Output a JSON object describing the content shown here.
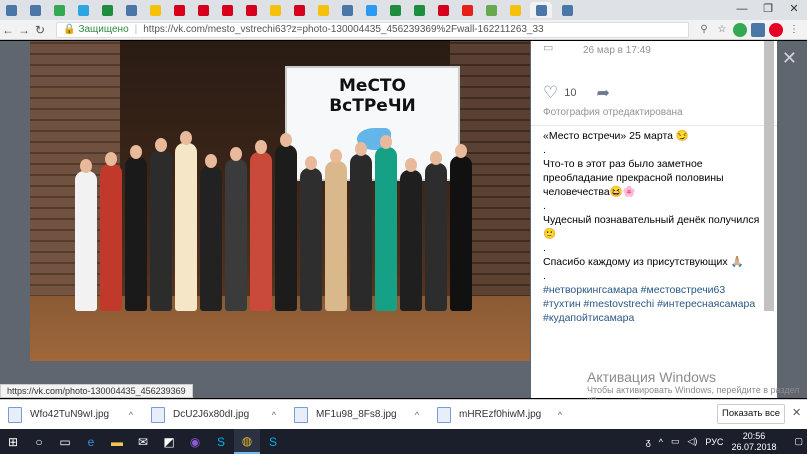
{
  "browser": {
    "tabs": [
      {
        "icon": "vk-icon",
        "color": "#4a76a8"
      },
      {
        "icon": "vk-icon",
        "color": "#4a76a8"
      },
      {
        "icon": "g-icon",
        "color": "#34a853"
      },
      {
        "icon": "telegram-icon",
        "color": "#2ca5e0"
      },
      {
        "icon": "flag-icon",
        "color": "#1e8e3e"
      },
      {
        "icon": "vk-icon",
        "color": "#4a76a8"
      },
      {
        "icon": "yellow-icon",
        "color": "#f4c20d"
      },
      {
        "icon": "hh-icon",
        "color": "#d6001c"
      },
      {
        "icon": "hh-icon",
        "color": "#d6001c"
      },
      {
        "icon": "hh-icon",
        "color": "#d6001c"
      },
      {
        "icon": "square-icon",
        "color": "#d6001c"
      },
      {
        "icon": "yellow-icon",
        "color": "#f4c20d"
      },
      {
        "icon": "hh-icon",
        "color": "#d6001c"
      },
      {
        "icon": "yellow-icon",
        "color": "#f4c20d"
      },
      {
        "icon": "vk-icon",
        "color": "#4a76a8"
      },
      {
        "icon": "mail-icon",
        "color": "#2a9af3"
      },
      {
        "icon": "flag-icon",
        "color": "#1e8e3e"
      },
      {
        "icon": "flag-icon",
        "color": "#1e8e3e"
      },
      {
        "icon": "hh-icon",
        "color": "#d6001c"
      },
      {
        "icon": "youtube-icon",
        "color": "#e62117"
      },
      {
        "icon": "sheet-icon",
        "color": "#6aa84f"
      },
      {
        "icon": "yellow-icon",
        "color": "#f4c20d"
      },
      {
        "icon": "vk-icon",
        "color": "#4a76a8"
      },
      {
        "icon": "vk-icon",
        "color": "#4a76a8"
      }
    ],
    "secure_label": "Защищено",
    "url": "https://vk.com/mesto_vstrechi63?z=photo-130004435_456239369%2Fwall-162211263_33"
  },
  "photo": {
    "screen_line1": "МеСТО",
    "screen_line2": "ВсТРеЧИ"
  },
  "post": {
    "date": "26 мар в 17:49",
    "likes": "10",
    "edited": "Фотография отредактирована",
    "lines": [
      "«Место встречи» 25 марта 😏",
      ".",
      "Что-то в этот раз было заметное преобладание прекрасной половины человечества😆🌸",
      ".",
      "Чудесный познавательный денёк получился 🙂",
      ".",
      "Спасибо каждому из присутствующих 🙏🏼",
      "."
    ],
    "tags_line1": "#нетворкингсамара #местовстречи63",
    "tags_line2": "#тухтин #mestovstrechi #интереснаясамара",
    "tags_line3": "#кудапойтисамара"
  },
  "windows_watermark": {
    "title": "Активация Windows",
    "text": "Чтобы активировать Windows, перейдите в раздел \"Параметры\"."
  },
  "status_url": "https://vk.com/photo-130004435_456239369",
  "downloads": [
    {
      "name": "Wfo42TuN9wI.jpg"
    },
    {
      "name": "DcU2J6x80dI.jpg"
    },
    {
      "name": "MF1u98_8Fs8.jpg"
    },
    {
      "name": "mHREzf0hiwM.jpg"
    }
  ],
  "show_all_label": "Показать все",
  "taskbar": {
    "lang": "РУС",
    "time": "20:56",
    "date": "26.07.2018"
  }
}
